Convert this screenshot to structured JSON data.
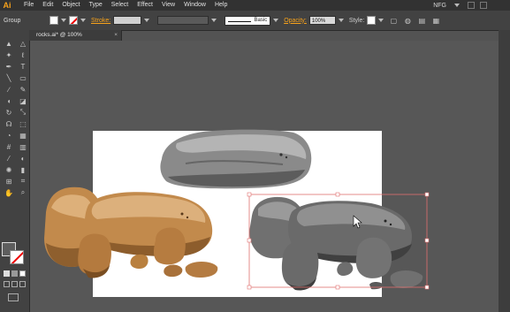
{
  "app": {
    "logo": "Ai"
  },
  "menu": [
    "File",
    "Edit",
    "Object",
    "Type",
    "Select",
    "Effect",
    "View",
    "Window",
    "Help"
  ],
  "workspace": "NFG",
  "control_bar": {
    "selection_label": "Group",
    "stroke_label": "Stroke:",
    "brush_label": "Basic",
    "opacity_label": "Opacity:",
    "opacity_value": "100%",
    "style_label": "Style:"
  },
  "document_tab": {
    "title": "rocks.ai* @ 100% (RGB/Preview)",
    "close": "×"
  },
  "colors": {
    "accent": "#f7a21b",
    "selection": "#e0706f",
    "rock_brown": "#c28a4c",
    "rock_gray": "#6e6e6e",
    "rock_dark": "#3c3c3c"
  },
  "icons": [
    "ai-logo-icon",
    "selection-tool-icon",
    "direct-selection-tool-icon",
    "magic-wand-icon",
    "lasso-icon",
    "pen-tool-icon",
    "type-tool-icon",
    "line-tool-icon",
    "rectangle-tool-icon",
    "paintbrush-icon",
    "pencil-icon",
    "blob-brush-icon",
    "eraser-icon",
    "rotate-icon",
    "scale-icon",
    "warp-icon",
    "free-transform-icon",
    "shape-builder-icon",
    "perspective-grid-icon",
    "mesh-icon",
    "gradient-icon",
    "eyedropper-icon",
    "blend-icon",
    "symbol-sprayer-icon",
    "graph-icon",
    "artboard-icon",
    "slice-icon",
    "hand-icon",
    "zoom-icon"
  ]
}
